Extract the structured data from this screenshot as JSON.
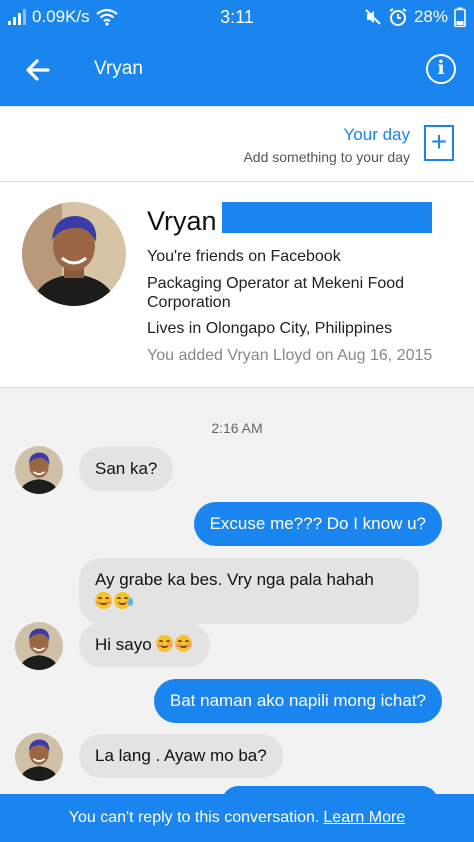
{
  "status_bar": {
    "network_speed": "0.09K/s",
    "time": "3:11",
    "battery": "28%"
  },
  "app_bar": {
    "title": "Vryan"
  },
  "your_day": {
    "title": "Your day",
    "subtitle": "Add something to your day",
    "plus": "+"
  },
  "profile": {
    "name": "Vryan",
    "friends": "You're friends on Facebook",
    "work": "Packaging Operator at Mekeni Food Corporation",
    "lives": "Lives in Olongapo City, Philippines",
    "added": "You added Vryan Lloyd on Aug 16, 2015"
  },
  "chat": {
    "timestamp": "2:16 AM",
    "messages": [
      {
        "dir": "in",
        "text": "San ka?"
      },
      {
        "dir": "out",
        "text": "Excuse me??? Do I know u?"
      },
      {
        "dir": "in",
        "text": "Ay grabe ka bes. Vry nga pala hahah",
        "emojis": [
          "smiling-face-icon",
          "tears-of-joy-icon"
        ]
      },
      {
        "dir": "in",
        "text": "Hi sayo",
        "emojis": [
          "smiling-face-icon",
          "smiling-face-icon"
        ]
      },
      {
        "dir": "out",
        "text": "Bat naman ako napili mong ichat?"
      },
      {
        "dir": "in",
        "text": "La lang . Ayaw mo ba?"
      }
    ]
  },
  "footer": {
    "notice": "You can't reply to this conversation.",
    "link": "Learn More"
  },
  "colors": {
    "brand": "#1a84ef",
    "incoming_bubble": "#e3e3e3"
  }
}
